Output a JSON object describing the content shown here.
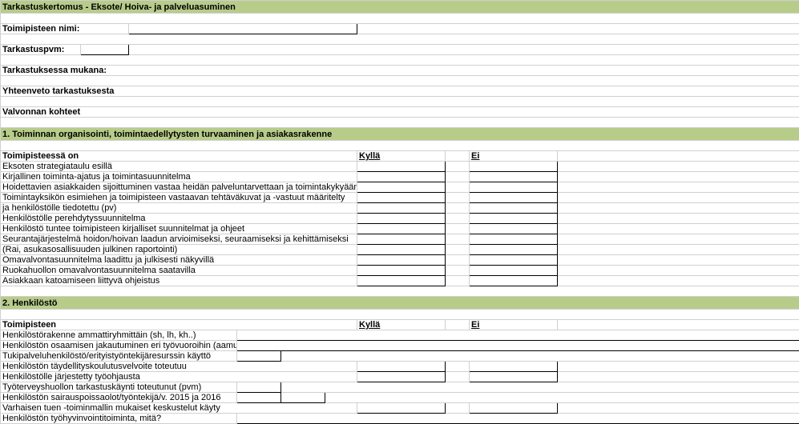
{
  "header": {
    "title": "Tarkastuskertomus  - Eksote/ Hoiva- ja palveluasuminen"
  },
  "form": {
    "toimipiste_label": "Toimipisteen nimi:",
    "tarkastuspvm_label": "Tarkastuspvm:",
    "mukana_label": "Tarkastuksessa mukana:",
    "yhteenveto_label": "Yhteenveto tarkastuksesta",
    "valvonnan_label": "Valvonnan kohteet"
  },
  "section1": {
    "title": "1. Toiminnan organisointi, toimintaedellytysten turvaaminen ja asiakasrakenne",
    "sub": "Toimipisteessä on",
    "col_yes": "Kyllä",
    "col_no": "Ei",
    "rows": [
      "Eksoten strategiataulu esillä",
      "Kirjallinen toiminta-ajatus ja toimintasuunnitelma",
      "Hoidettavien asiakkaiden sijoittuminen vastaa heidän palveluntarvettaan ja toimintakykyään",
      "Toimintayksikön esimiehen ja toimipisteen vastaavan tehtäväkuvat ja -vastuut  määritelty",
      "ja henkilöstölle tiedotettu (pv)",
      "Henkilöstölle perehdytyssuunnitelma",
      "Henkilöstö tuntee toimipisteen kirjalliset suunnitelmat ja ohjeet",
      "Seurantajärjestelmä hoidon/hoivan laadun arvioimiseksi, seuraamiseksi ja kehittämiseksi",
      "(Rai, asukasosallisuuden julkinen raportointi)",
      "Omavalvontasuunnitelma laadittu ja julkisesti näkyvillä",
      "Ruokahuollon omavalvontasuunnitelma saatavilla",
      "Asiakkaan katoamiseen liittyvä ohjeistus"
    ]
  },
  "section2": {
    "title": "2. Henkilöstö",
    "sub": "Toimipisteen",
    "col_yes": "Kyllä",
    "col_no": "Ei",
    "rows": [
      "Henkilöstörakenne  ammattiryhmittäin (sh, lh, kh..)",
      "Henkilöstön osaamisen jakautuminen eri työvuoroihin (aamu, ilta, yö)",
      "Tukipalveluhenkilöstö/erityistyöntekijäresurssin käyttö",
      "Henkilöstön täydellityskoulutusvelvoite toteutuu",
      "Henkilöstölle  järjestetty työohjausta",
      "Työterveyshuollon tarkastuskäynti  toteutunut (pvm)",
      "Henkilöstön sairauspoissaolot/työntekijä/v. 2015 ja 2016",
      "Varhaisen tuen -toiminmallin mukaiset keskustelut käyty",
      "Henkilöstön työhyvinvointitoiminta, mitä?"
    ]
  }
}
